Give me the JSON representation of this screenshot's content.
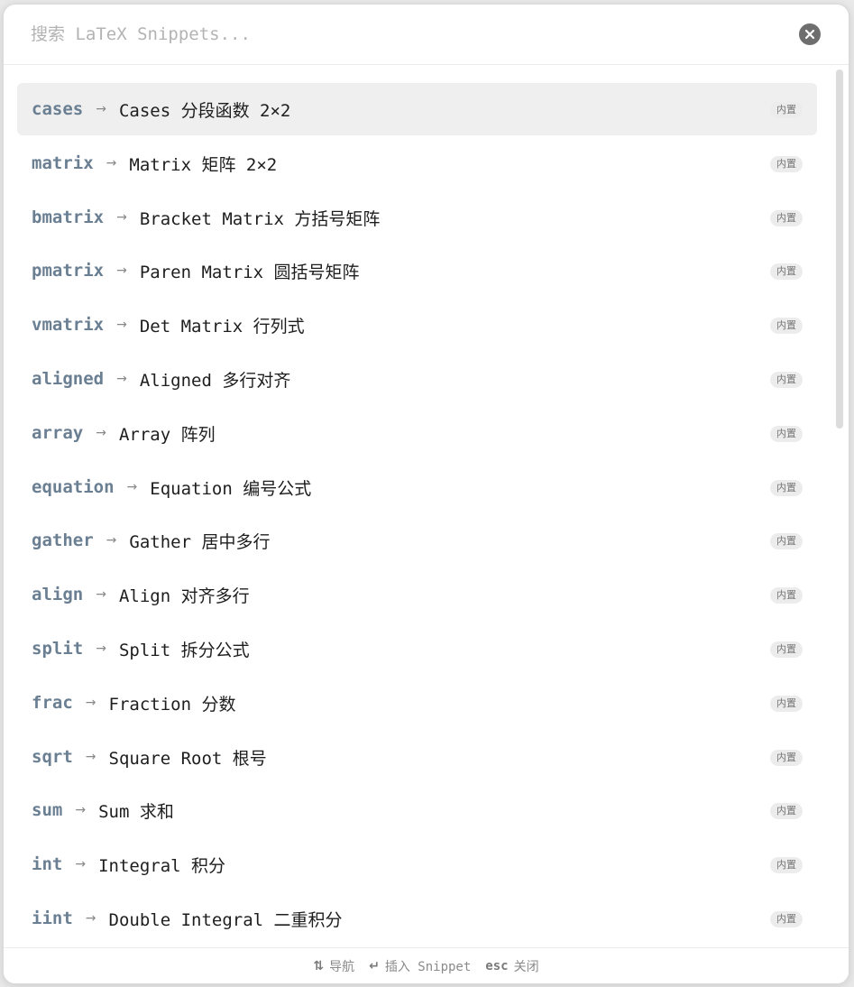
{
  "search": {
    "placeholder": "搜索 LaTeX Snippets..."
  },
  "close_icon": "close-icon",
  "selected_index": 0,
  "badge_color": "#ececec",
  "trigger_color": "#6b7f93",
  "arrow_glyph": "→",
  "snippets": [
    {
      "trigger": "cases",
      "desc": "Cases 分段函数 2×2",
      "badge": "内置"
    },
    {
      "trigger": "matrix",
      "desc": "Matrix 矩阵 2×2",
      "badge": "内置"
    },
    {
      "trigger": "bmatrix",
      "desc": "Bracket Matrix 方括号矩阵",
      "badge": "内置"
    },
    {
      "trigger": "pmatrix",
      "desc": "Paren Matrix 圆括号矩阵",
      "badge": "内置"
    },
    {
      "trigger": "vmatrix",
      "desc": "Det Matrix 行列式",
      "badge": "内置"
    },
    {
      "trigger": "aligned",
      "desc": "Aligned 多行对齐",
      "badge": "内置"
    },
    {
      "trigger": "array",
      "desc": "Array 阵列",
      "badge": "内置"
    },
    {
      "trigger": "equation",
      "desc": "Equation 编号公式",
      "badge": "内置"
    },
    {
      "trigger": "gather",
      "desc": "Gather 居中多行",
      "badge": "内置"
    },
    {
      "trigger": "align",
      "desc": "Align 对齐多行",
      "badge": "内置"
    },
    {
      "trigger": "split",
      "desc": "Split 拆分公式",
      "badge": "内置"
    },
    {
      "trigger": "frac",
      "desc": "Fraction 分数",
      "badge": "内置"
    },
    {
      "trigger": "sqrt",
      "desc": "Square Root 根号",
      "badge": "内置"
    },
    {
      "trigger": "sum",
      "desc": "Sum 求和",
      "badge": "内置"
    },
    {
      "trigger": "int",
      "desc": "Integral 积分",
      "badge": "内置"
    },
    {
      "trigger": "iint",
      "desc": "Double Integral 二重积分",
      "badge": "内置"
    }
  ],
  "footer": {
    "nav_key": "⇅",
    "nav_label": "导航",
    "insert_key": "↵",
    "insert_label": "插入 Snippet",
    "close_key": "esc",
    "close_label": "关闭"
  }
}
